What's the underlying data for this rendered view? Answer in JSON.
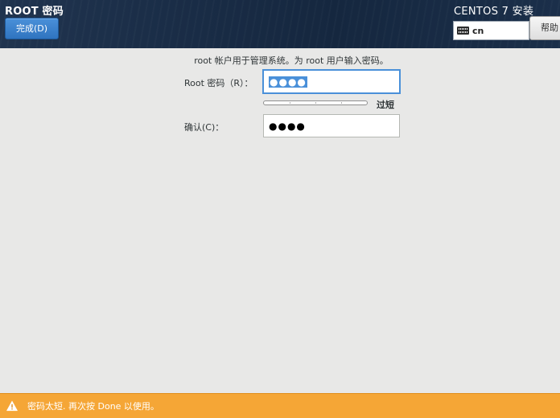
{
  "header": {
    "page_title": "ROOT 密码",
    "done_label": "完成(D)",
    "install_title": "CENTOS 7 安装",
    "keyboard_layout": "cn",
    "help_label": "帮助"
  },
  "form": {
    "info_text": "root 帐户用于管理系统。为 root 用户输入密码。",
    "root_password_label": "Root 密码（R）：",
    "root_password_value": "●●●●",
    "strength": {
      "label": "过短",
      "level": 0.0
    },
    "confirm_label": "确认(C)：",
    "confirm_value": "●●●●"
  },
  "warning": {
    "text": "密码太短. 再次按 Done 以使用。"
  },
  "colors": {
    "header_bg": "#1a2d47",
    "done_button": "#3a82cf",
    "focus_accent": "#4a90d9",
    "warning_bg": "#f5a636",
    "page_bg": "#e8e8e7"
  },
  "icons": {
    "keyboard": "keyboard-icon",
    "warning": "warning-triangle-icon"
  }
}
